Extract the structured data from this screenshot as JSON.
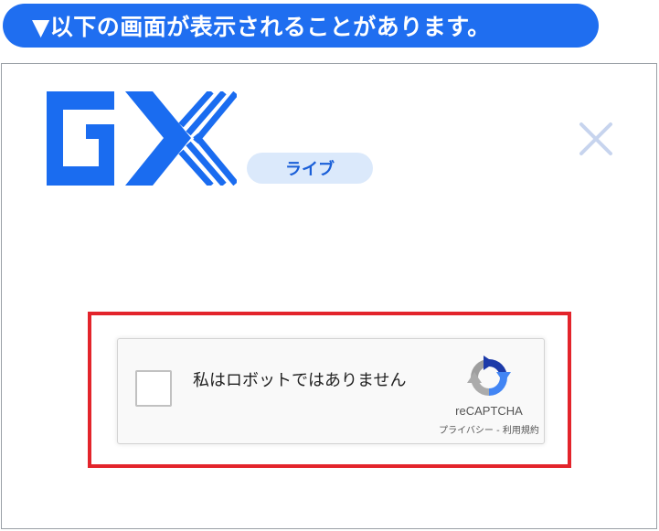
{
  "banner": {
    "text": "▼以下の画面が表示されることがあります。"
  },
  "header": {
    "badge_label": "ライブ"
  },
  "recaptcha": {
    "label": "私はロボットではありません",
    "brand": "reCAPTCHA",
    "privacy_link": "プライバシー",
    "separator": " - ",
    "terms_link": "利用規約"
  },
  "colors": {
    "banner_bg": "#1f6ef0",
    "logo_blue": "#1a6cf0",
    "badge_bg": "#dbe9fb",
    "highlight_red": "#e3242b",
    "close_icon": "#c7d4ee"
  }
}
